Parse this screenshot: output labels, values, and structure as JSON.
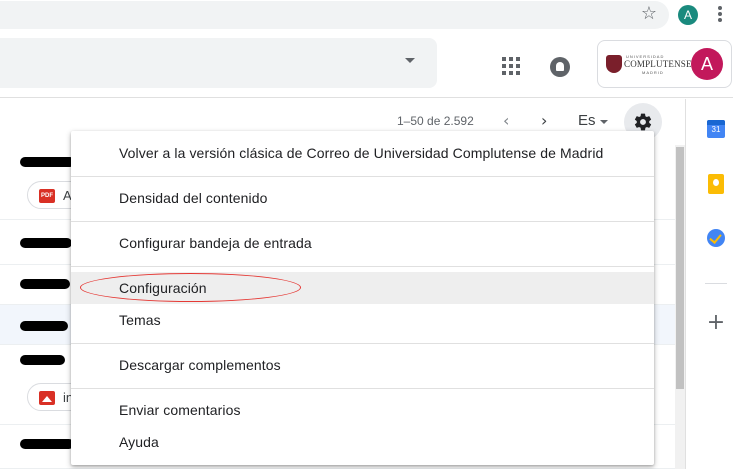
{
  "browser": {
    "profile_initial": "A",
    "star_icon": "star-outline-icon",
    "menu_icon": "kebab-menu-icon"
  },
  "header": {
    "apps_icon": "apps-grid-icon",
    "notifications_icon": "notification-bell-icon",
    "org_logo": {
      "top_text": "UNIVERSIDAD",
      "main_text": "COMPLUTENSE",
      "bottom_text": "MADRID"
    },
    "account_initial": "A",
    "account_color": "#c2185b"
  },
  "toolbar": {
    "pagination": "1–50 de 2.592",
    "prev_icon": "chevron-left-icon",
    "next_icon": "chevron-right-icon",
    "language": "Es",
    "settings_icon": "gear-icon"
  },
  "mail_list": {
    "attachments": [
      {
        "type": "pdf-icon",
        "label": "A",
        "badge": "PDF"
      },
      {
        "type": "image-icon",
        "label": "in"
      }
    ]
  },
  "side_panel": {
    "calendar_day": "31",
    "icons": [
      "calendar-icon",
      "keep-icon",
      "tasks-icon",
      "add-icon"
    ],
    "add_symbol": "+"
  },
  "settings_menu": {
    "items": [
      {
        "label": "Volver a la versión clásica de Correo de Universidad Complutense de Madrid"
      },
      {
        "label": "Densidad del contenido"
      },
      {
        "label": "Configurar bandeja de entrada"
      },
      {
        "label": "Configuración",
        "highlighted": true
      },
      {
        "label": "Temas"
      },
      {
        "label": "Descargar complementos"
      },
      {
        "label": "Enviar comentarios"
      },
      {
        "label": "Ayuda"
      }
    ],
    "annotation_color": "#e53935"
  }
}
